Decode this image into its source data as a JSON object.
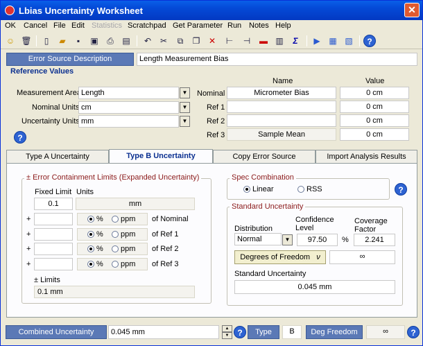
{
  "window": {
    "title": "Lbias Uncertainty Worksheet"
  },
  "menu": {
    "items": [
      "OK",
      "Cancel",
      "File",
      "Edit",
      "Statistics",
      "Scratchpad",
      "Get Parameter",
      "Run",
      "Notes",
      "Help"
    ]
  },
  "error_source": {
    "label": "Error Source Description",
    "value": "Length Measurement Bias"
  },
  "reference": {
    "title": "Reference Values",
    "name_header": "Name",
    "value_header": "Value",
    "measurement_area_label": "Measurement Area",
    "measurement_area_value": "Length",
    "nominal_units_label": "Nominal Units",
    "nominal_units_value": "cm",
    "uncertainty_units_label": "Uncertainty Units",
    "uncertainty_units_value": "mm",
    "rows": [
      {
        "label": "Nominal",
        "name": "Micrometer Bias",
        "value": "0 cm"
      },
      {
        "label": "Ref 1",
        "name": "",
        "value": "0 cm"
      },
      {
        "label": "Ref 2",
        "name": "",
        "value": "0 cm"
      },
      {
        "label": "Ref 3",
        "name": "Sample Mean",
        "value": "0 cm"
      }
    ]
  },
  "tabs": [
    "Type A Uncertainty",
    "Type B Uncertainty",
    "Copy Error Source",
    "Import Analysis Results"
  ],
  "limits": {
    "title": "± Error Containment Limits (Expanded Uncertainty)",
    "fixed_label": "Fixed Limit",
    "units_label": "Units",
    "fixed_value": "0.1",
    "units_value": "mm",
    "plus": "+",
    "pct": "%",
    "ppm": "ppm",
    "rows": [
      "of Nominal",
      "of Ref 1",
      "of Ref 2",
      "of Ref 3"
    ],
    "limits_label": "± Limits",
    "limits_value": "0.1 mm"
  },
  "spec": {
    "title": "Spec Combination",
    "linear": "Linear",
    "rss": "RSS"
  },
  "std": {
    "title": "Standard Uncertainty",
    "dist_label": "Distribution",
    "dist_value": "Normal",
    "conf_label": "Confidence Level",
    "conf_value": "97.50",
    "pct": "%",
    "cov_label": "Coverage Factor",
    "cov_value": "2.241",
    "dof_button": "Degrees of Freedom",
    "dof_symbol": "ν",
    "dof_value": "∞",
    "std_label": "Standard Uncertainty",
    "std_value": "0.045 mm"
  },
  "status": {
    "combined_label": "Combined Uncertainty",
    "combined_value": "0.045 mm",
    "type_label": "Type",
    "type_value": "B",
    "deg_label": "Deg Freedom",
    "deg_value": "∞"
  },
  "colors": {
    "titlebar": "#0449D6",
    "header_blue": "#5B79B6",
    "section_blue": "#0A2F90",
    "group_title_red": "#8B1A1A"
  }
}
